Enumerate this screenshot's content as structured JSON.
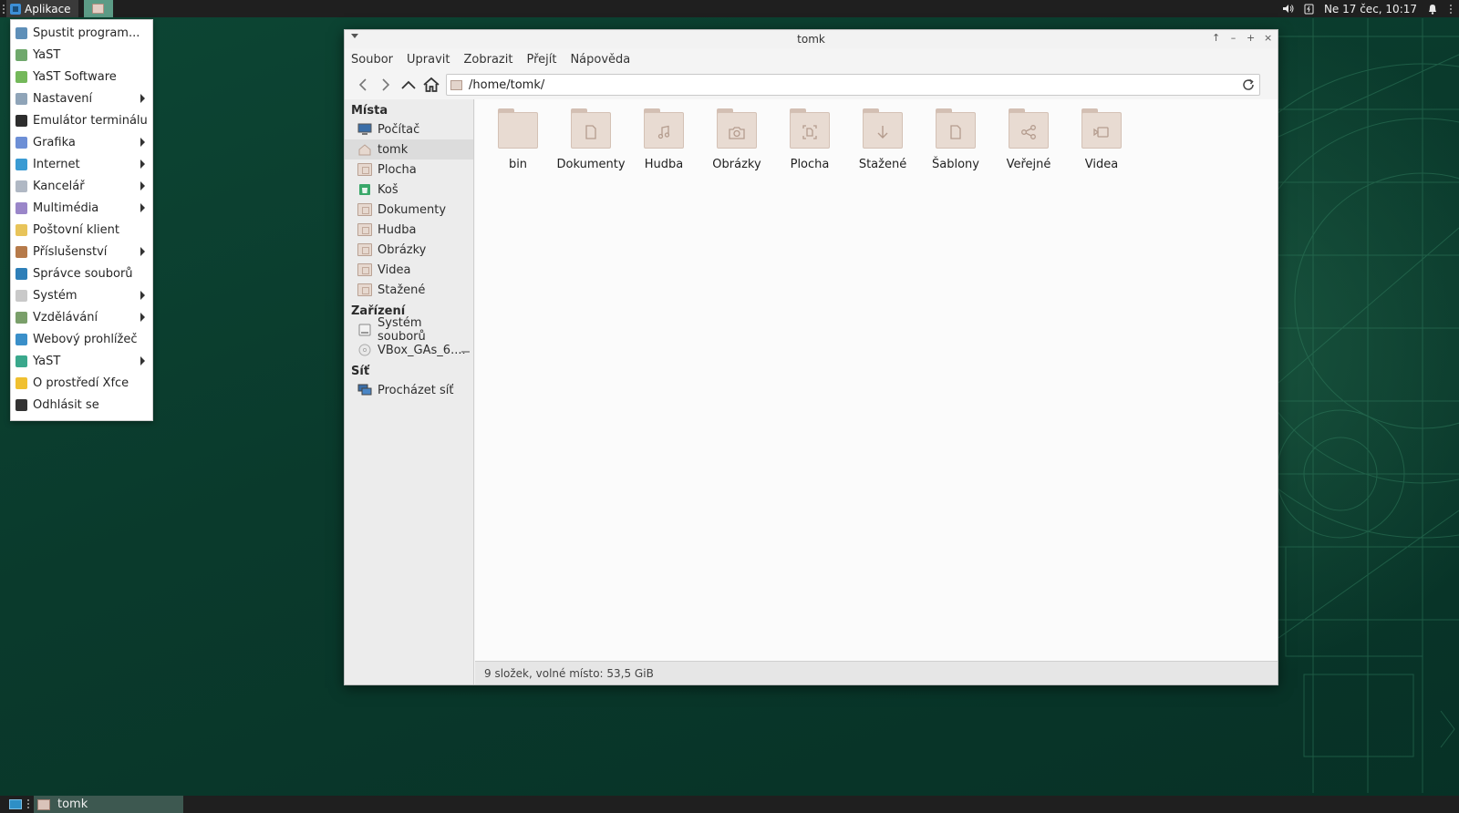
{
  "top_panel": {
    "apps_label": "Aplikace",
    "clock": "Ne 17 čec, 10:17",
    "tray_icons": [
      "volume-icon",
      "power-icon",
      "bell-icon"
    ]
  },
  "app_menu": {
    "items": [
      {
        "label": "Spustit program...",
        "icon": "search-icon",
        "color": "#5e8fb8",
        "submenu": false
      },
      {
        "label": "YaST",
        "icon": "yast-icon",
        "color": "#6fa86c",
        "submenu": false
      },
      {
        "label": "YaST Software",
        "icon": "yast-software-icon",
        "color": "#74b85a",
        "submenu": false
      },
      {
        "label": "Nastavení",
        "icon": "settings-icon",
        "color": "#8fa4b8",
        "submenu": true
      },
      {
        "label": "Emulátor terminálu",
        "icon": "terminal-icon",
        "color": "#2d2d2d",
        "submenu": false
      },
      {
        "label": "Grafika",
        "icon": "graphics-icon",
        "color": "#6d8fd6",
        "submenu": true
      },
      {
        "label": "Internet",
        "icon": "internet-icon",
        "color": "#3a9bd3",
        "submenu": true
      },
      {
        "label": "Kancelář",
        "icon": "office-icon",
        "color": "#b0b8c4",
        "submenu": true
      },
      {
        "label": "Multimédia",
        "icon": "multimedia-icon",
        "color": "#9a86c9",
        "submenu": true
      },
      {
        "label": "Poštovní klient",
        "icon": "mail-icon",
        "color": "#e8c45a",
        "submenu": false
      },
      {
        "label": "Příslušenství",
        "icon": "accessories-icon",
        "color": "#b67a4a",
        "submenu": true
      },
      {
        "label": "Správce souborů",
        "icon": "file-manager-icon",
        "color": "#2e7fb8",
        "submenu": false
      },
      {
        "label": "Systém",
        "icon": "system-icon",
        "color": "#c9c9c9",
        "submenu": true
      },
      {
        "label": "Vzdělávání",
        "icon": "education-icon",
        "color": "#7a9f6a",
        "submenu": true
      },
      {
        "label": "Webový prohlížeč",
        "icon": "web-browser-icon",
        "color": "#3a8fc9",
        "submenu": false
      },
      {
        "label": "YaST",
        "icon": "yast-icon",
        "color": "#3aa88c",
        "submenu": true
      },
      {
        "label": "O prostředí Xfce",
        "icon": "star-icon",
        "color": "#f0c030",
        "submenu": false
      },
      {
        "label": "Odhlásit se",
        "icon": "logout-icon",
        "color": "#333333",
        "submenu": false
      }
    ]
  },
  "window": {
    "title": "tomk",
    "menubar": [
      "Soubor",
      "Upravit",
      "Zobrazit",
      "Přejít",
      "Nápověda"
    ],
    "location": "/home/tomk/",
    "sidebar": {
      "places_header": "Místa",
      "places": [
        "Počítač",
        "tomk",
        "Plocha",
        "Koš",
        "Dokumenty",
        "Hudba",
        "Obrázky",
        "Videa",
        "Stažené"
      ],
      "devices_header": "Zařízení",
      "devices": [
        "Systém souborů",
        "VBox_GAs_6...."
      ],
      "network_header": "Síť",
      "network": [
        "Procházet síť"
      ]
    },
    "folders": [
      {
        "label": "bin",
        "glyph": "none"
      },
      {
        "label": "Dokumenty",
        "glyph": "document"
      },
      {
        "label": "Hudba",
        "glyph": "music"
      },
      {
        "label": "Obrázky",
        "glyph": "camera"
      },
      {
        "label": "Plocha",
        "glyph": "desktop"
      },
      {
        "label": "Stažené",
        "glyph": "download"
      },
      {
        "label": "Šablony",
        "glyph": "template"
      },
      {
        "label": "Veřejné",
        "glyph": "share"
      },
      {
        "label": "Videa",
        "glyph": "video"
      }
    ],
    "status": "9 složek, volné místo: 53,5 GiB"
  },
  "taskbar": {
    "task_label": "tomk"
  },
  "colors": {
    "desktop": "#0a3a2c",
    "panel": "#1f1f1f",
    "folder": "#e8dbd2"
  }
}
